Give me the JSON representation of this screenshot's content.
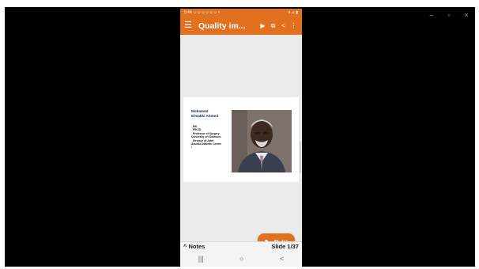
{
  "window": {
    "controls": [
      "–",
      "▫",
      "×"
    ]
  },
  "phone": {
    "status": {
      "left": "5:44 ☺☺☺☺☺☺ •",
      "right": "▾ ⊿ ▮"
    },
    "app_bar": {
      "menu_icon": "☰",
      "title": "Quality im...",
      "icons": [
        "play-icon",
        "cast-icon",
        "share-icon",
        "more-icon"
      ],
      "glyphs": [
        "▶",
        "⧉",
        "<",
        "⋮"
      ]
    },
    "slide": {
      "name": "Mohamed\nElmakki Ahmed",
      "details": "_MS\n_FRCSI\n_Professor of Surgery\nUniversity of Khartoum\n_Director of Jabir\nAbuelIz Diabetic Centre\n/"
    },
    "edit_button": {
      "icon": "✎",
      "label": "Edit"
    },
    "notes_bar": {
      "notes_label": "^ Notes",
      "slide_counter": "Slide 1/37"
    },
    "nav": [
      "|||",
      "○",
      "<"
    ]
  },
  "colors": {
    "accent": "#e1701f",
    "name_text": "#1f2a66",
    "background": "#000000"
  }
}
